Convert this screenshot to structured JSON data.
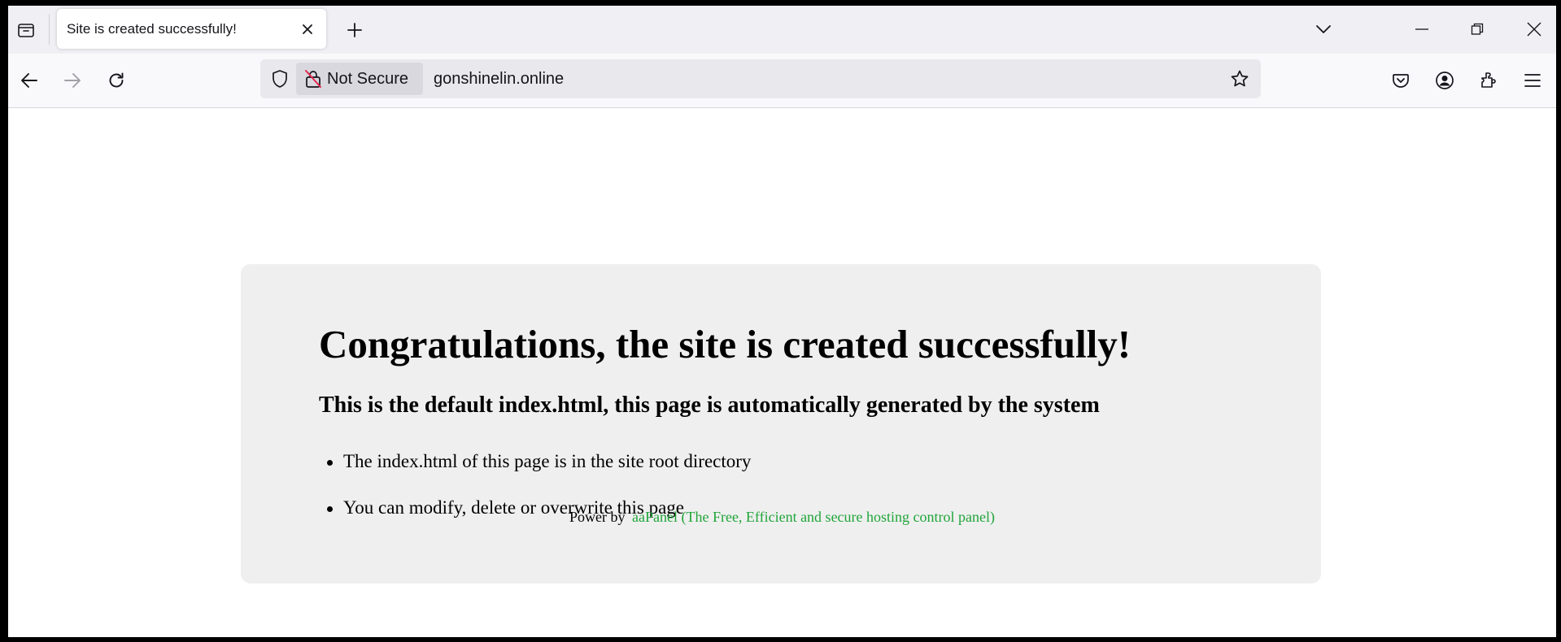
{
  "browser": {
    "tab": {
      "title": "Site is created successfully!"
    },
    "url": "gonshinelin.online",
    "security_label": "Not Secure"
  },
  "page": {
    "heading": "Congratulations, the site is created successfully!",
    "subheading": "This is the default index.html, this page is automatically generated by the system",
    "bullets": [
      "The index.html of this page is in the site root directory",
      "You can modify, delete or overwrite this page"
    ],
    "footer_prefix": "Power by",
    "footer_link": "aaPanel (The Free, Efficient and secure hosting control panel)"
  },
  "colors": {
    "link_green": "#20a53a",
    "card_bg": "#efefef"
  }
}
